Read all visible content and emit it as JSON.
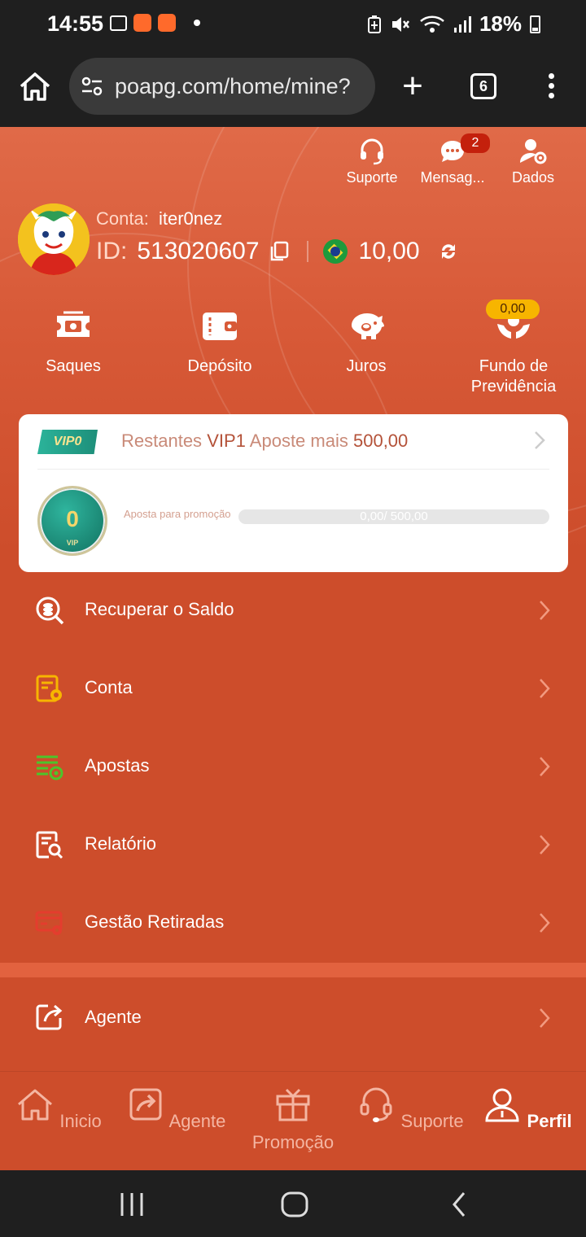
{
  "status_bar": {
    "time": "14:55",
    "battery": "18%"
  },
  "browser": {
    "url": "poapg.com/home/mine?",
    "tab_count": "6"
  },
  "top_actions": [
    {
      "label": "Suporte",
      "icon": "headset-icon"
    },
    {
      "label": "Mensag...",
      "icon": "chat-icon",
      "badge": "2"
    },
    {
      "label": "Dados",
      "icon": "user-settings-icon"
    }
  ],
  "profile": {
    "account_label": "Conta:",
    "account_name": "iter0nez",
    "id_label": "ID:",
    "id_value": "513020607",
    "balance": "10,00"
  },
  "quick_actions": [
    {
      "label": "Saques",
      "icon": "cash-ticket-icon"
    },
    {
      "label": "Depósito",
      "icon": "wallet-icon"
    },
    {
      "label": "Juros",
      "icon": "piggy-bank-icon"
    },
    {
      "label_line1": "Fundo de",
      "label_line2": "Previdência",
      "icon": "hands-coin-icon",
      "badge": "0,00"
    }
  ],
  "vip": {
    "badge": "VIP0",
    "remaining_label": "Restantes",
    "next_level": "VIP1",
    "bet_more_label": "Aposte mais",
    "bet_more_value": "500,00",
    "medal_level": "0",
    "medal_tag": "VIP",
    "progress_label": "Aposta para promoção",
    "progress_text": "0,00/ 500,00",
    "progress_fraction": 0
  },
  "menu": [
    {
      "label": "Recuperar o Saldo",
      "icon": "recover-balance-icon"
    },
    {
      "label": "Conta",
      "icon": "account-doc-icon"
    },
    {
      "label": "Apostas",
      "icon": "bets-list-icon"
    },
    {
      "label": "Relatório",
      "icon": "report-search-icon"
    },
    {
      "label": "Gestão Retiradas",
      "icon": "withdraw-settings-icon"
    }
  ],
  "agent_row": {
    "label": "Agente",
    "icon": "share-icon"
  },
  "tabbar": [
    {
      "label": "Inicio",
      "icon": "home-icon"
    },
    {
      "label": "Agente",
      "icon": "share-icon"
    },
    {
      "label": "Promoção",
      "icon": "gift-icon"
    },
    {
      "label": "Suporte",
      "icon": "headset-icon"
    },
    {
      "label": "Perfil",
      "icon": "person-icon",
      "active": true
    }
  ],
  "colors": {
    "app_background": "#cd4d2b",
    "vip_teal": "#2bb39a",
    "badge_red": "#c4200c",
    "gold_pill": "#f7b500"
  }
}
